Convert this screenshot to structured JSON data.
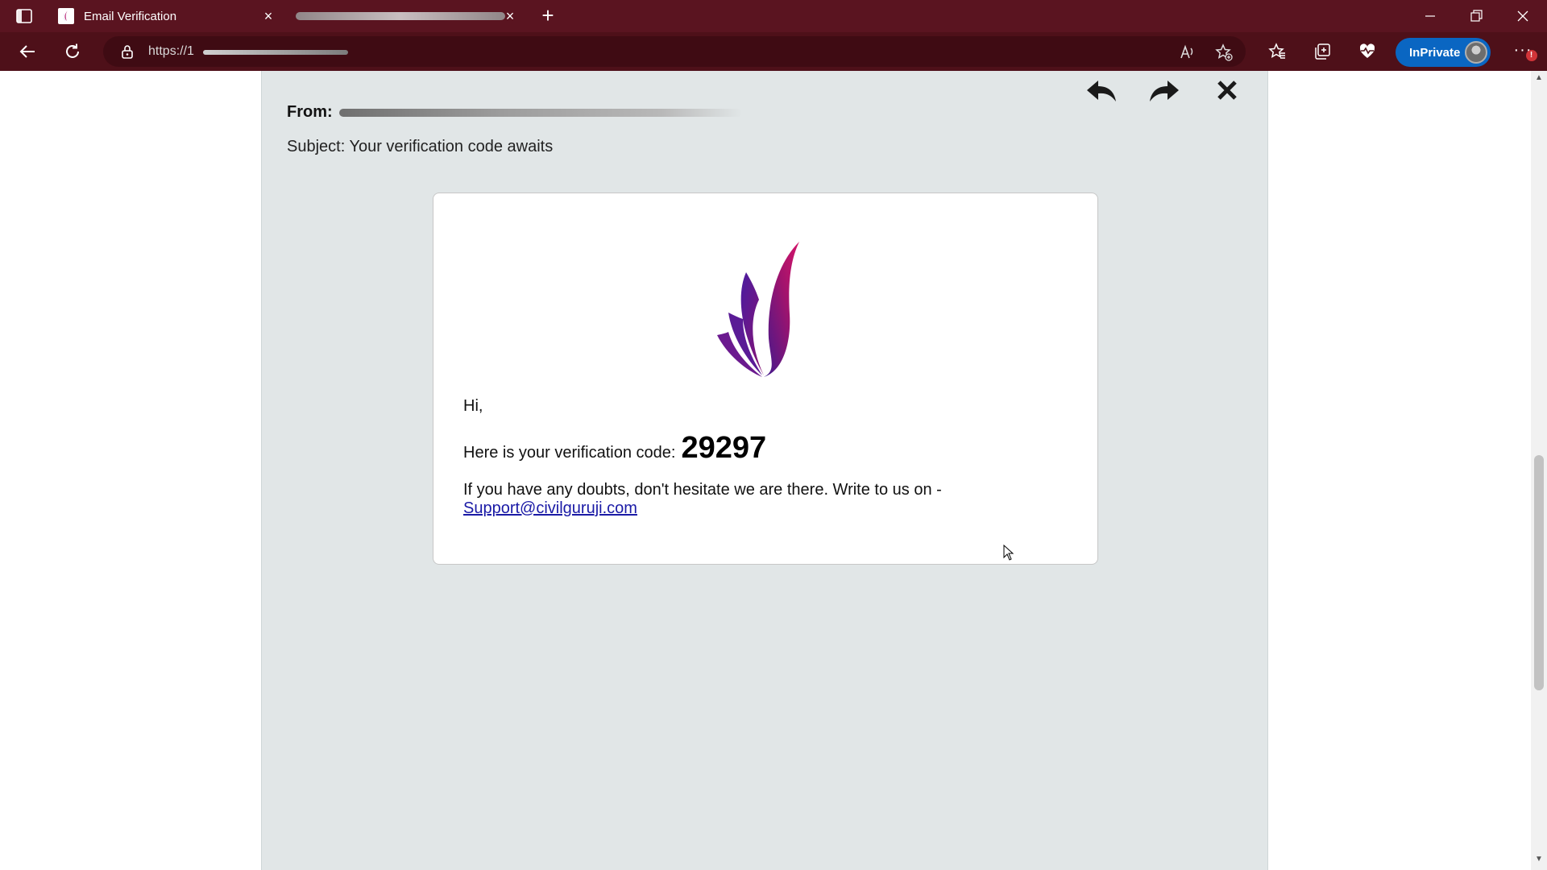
{
  "browser": {
    "tabs": [
      {
        "title": "Email Verification",
        "favicon": "flame-logo-icon",
        "active": true
      },
      {
        "title": "",
        "active": false
      }
    ],
    "address": {
      "url_visible": "https://1"
    },
    "inprivate_label": "InPrivate",
    "menu_badge": "!"
  },
  "email": {
    "from_label": "From:",
    "subject": "Subject: Your verification code awaits",
    "greeting": "Hi,",
    "code_prefix": "Here is your verification code:",
    "code": "29297",
    "doubts_text": "If you have any doubts, don't hesitate we are there. Write to us on -",
    "support_email": "Support@civilguruji.com"
  },
  "colors": {
    "titlebar": "#5a1420",
    "toolbar": "#4e1019",
    "inprivate": "#0a66c2",
    "panel_bg": "#e1e6e7",
    "link": "#1a1aa6",
    "logo_gradient": [
      "#3d1a8f",
      "#a0136d",
      "#d4156a"
    ]
  }
}
